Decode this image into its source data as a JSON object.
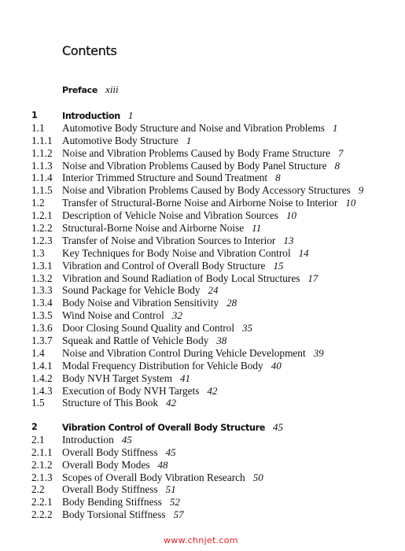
{
  "heading": "Contents",
  "preface": {
    "label": "Preface",
    "page": "xiii"
  },
  "chapters": [
    {
      "entries": [
        {
          "num": "1",
          "title": "Introduction",
          "page": "1"
        },
        {
          "num": "1.1",
          "title": "Automotive Body Structure and Noise and Vibration Problems",
          "page": "1"
        },
        {
          "num": "1.1.1",
          "title": "Automotive Body Structure",
          "page": "1"
        },
        {
          "num": "1.1.2",
          "title": "Noise and Vibration Problems Caused by Body Frame Structure",
          "page": "7"
        },
        {
          "num": "1.1.3",
          "title": "Noise and Vibration Problems Caused by Body Panel Structure",
          "page": "8"
        },
        {
          "num": "1.1.4",
          "title": "Interior Trimmed Structure and Sound Treatment",
          "page": "8"
        },
        {
          "num": "1.1.5",
          "title": "Noise and Vibration Problems Caused by Body Accessory Structures",
          "page": "9"
        },
        {
          "num": "1.2",
          "title": "Transfer of Structural-Borne Noise and Airborne Noise to Interior",
          "page": "10"
        },
        {
          "num": "1.2.1",
          "title": "Description of Vehicle Noise and Vibration Sources",
          "page": "10"
        },
        {
          "num": "1.2.2",
          "title": "Structural-Borne Noise and Airborne Noise",
          "page": "11"
        },
        {
          "num": "1.2.3",
          "title": "Transfer of Noise and Vibration Sources to Interior",
          "page": "13"
        },
        {
          "num": "1.3",
          "title": "Key Techniques for Body Noise and Vibration Control",
          "page": "14"
        },
        {
          "num": "1.3.1",
          "title": "Vibration and Control of Overall Body Structure",
          "page": "15"
        },
        {
          "num": "1.3.2",
          "title": "Vibration and Sound Radiation of Body Local Structures",
          "page": "17"
        },
        {
          "num": "1.3.3",
          "title": "Sound Package for Vehicle Body",
          "page": "24"
        },
        {
          "num": "1.3.4",
          "title": "Body Noise and Vibration Sensitivity",
          "page": "28"
        },
        {
          "num": "1.3.5",
          "title": "Wind Noise and Control",
          "page": "32"
        },
        {
          "num": "1.3.6",
          "title": "Door Closing Sound Quality and Control",
          "page": "35"
        },
        {
          "num": "1.3.7",
          "title": "Squeak and Rattle of Vehicle Body",
          "page": "38"
        },
        {
          "num": "1.4",
          "title": "Noise and Vibration Control During Vehicle Development",
          "page": "39"
        },
        {
          "num": "1.4.1",
          "title": "Modal Frequency Distribution for Vehicle Body",
          "page": "40"
        },
        {
          "num": "1.4.2",
          "title": "Body NVH Target System",
          "page": "41"
        },
        {
          "num": "1.4.3",
          "title": "Execution of Body NVH Targets",
          "page": "42"
        },
        {
          "num": "1.5",
          "title": "Structure of This Book",
          "page": "42"
        }
      ]
    },
    {
      "entries": [
        {
          "num": "2",
          "title": "Vibration Control of Overall Body Structure",
          "page": "45"
        },
        {
          "num": "2.1",
          "title": "Introduction",
          "page": "45"
        },
        {
          "num": "2.1.1",
          "title": "Overall Body Stiffness",
          "page": "45"
        },
        {
          "num": "2.1.2",
          "title": "Overall Body Modes",
          "page": "48"
        },
        {
          "num": "2.1.3",
          "title": "Scopes of Overall Body Vibration Research",
          "page": "50"
        },
        {
          "num": "2.2",
          "title": "Overall Body Stiffness",
          "page": "51"
        },
        {
          "num": "2.2.1",
          "title": "Body Bending Stiffness",
          "page": "52"
        },
        {
          "num": "2.2.2",
          "title": "Body Torsional Stiffness",
          "page": "57"
        }
      ]
    }
  ],
  "watermark": "www.chnjet.com",
  "colors": {
    "text": "#111111",
    "watermark": "#e8202a"
  }
}
